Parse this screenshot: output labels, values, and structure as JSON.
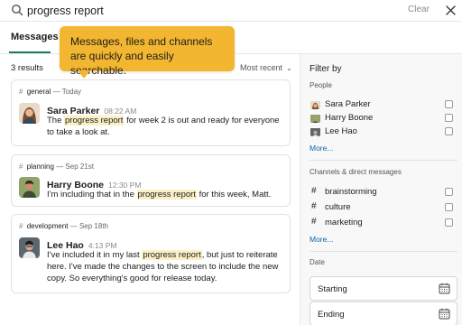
{
  "search": {
    "query": "progress report",
    "clear_label": "Clear"
  },
  "tabs": [
    {
      "label": "Messages",
      "active": true
    }
  ],
  "tooltip": {
    "text": "Messages, files and channels are quickly and easily searchable."
  },
  "results": {
    "count_label": "3 results",
    "sort_label": "Most recent"
  },
  "messages": [
    {
      "channel": "general",
      "date": "Today",
      "sender": "Sara Parker",
      "time": "08:22 AM",
      "text_before": "The ",
      "highlight": "progress report",
      "text_after": " for week 2 is out and ready for everyone to take a look at."
    },
    {
      "channel": "planning",
      "date": "Sep 21st",
      "sender": "Harry Boone",
      "time": "12:30 PM",
      "text_before": "I'm including that in the ",
      "highlight": "progress report",
      "text_after": " for this week, Matt."
    },
    {
      "channel": "development",
      "date": "Sep 18th",
      "sender": "Lee Hao",
      "time": "4:13 PM",
      "text_before": "I've included it in my last ",
      "highlight": "progress report",
      "text_after": ", but just to reiterate here. I've made the changes to the screen to include the new copy. So everything's good for release today."
    }
  ],
  "filter": {
    "title": "Filter by",
    "people_title": "People",
    "people": [
      {
        "name": "Sara Parker"
      },
      {
        "name": "Harry Boone"
      },
      {
        "name": "Lee Hao"
      }
    ],
    "people_more": "More...",
    "channels_title": "Channels & direct messages",
    "channels": [
      {
        "name": "brainstorming"
      },
      {
        "name": "culture"
      },
      {
        "name": "marketing"
      }
    ],
    "channels_more": "More...",
    "date_title": "Date",
    "date_start": "Starting",
    "date_end": "Ending"
  },
  "colors": {
    "tooltip": "#f2b630",
    "tab_underline": "#1b7a64",
    "highlight": "#fbf0c5",
    "link": "#1264a3"
  },
  "icons": {
    "search": "search-icon",
    "close": "close-icon",
    "sort": "chevron-down-icon",
    "calendar": "calendar-icon"
  }
}
